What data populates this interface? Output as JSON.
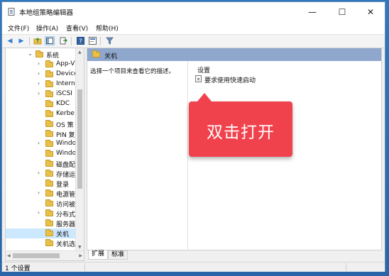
{
  "window": {
    "title": "本地组策略编辑器",
    "minimize": "—",
    "maximize": "☐",
    "close": "✕"
  },
  "menu": [
    {
      "label": "文件(F)"
    },
    {
      "label": "操作(A)"
    },
    {
      "label": "查看(V)"
    },
    {
      "label": "帮助(H)"
    }
  ],
  "tree": {
    "items": [
      {
        "label": "系统",
        "arrow": "open"
      },
      {
        "label": "App-V",
        "arrow": "closed"
      },
      {
        "label": "Device",
        "arrow": "closed"
      },
      {
        "label": "Intern",
        "arrow": "closed"
      },
      {
        "label": "iSCSI",
        "arrow": "closed"
      },
      {
        "label": "KDC",
        "arrow": "none"
      },
      {
        "label": "Kerbe",
        "arrow": "none"
      },
      {
        "label": "OS 策",
        "arrow": "none"
      },
      {
        "label": "PIN 复",
        "arrow": "none"
      },
      {
        "label": "Windo",
        "arrow": "closed"
      },
      {
        "label": "Windo",
        "arrow": "none"
      },
      {
        "label": "磁盘配",
        "arrow": "none"
      },
      {
        "label": "存储运",
        "arrow": "closed"
      },
      {
        "label": "登录",
        "arrow": "none"
      },
      {
        "label": "电源管",
        "arrow": "closed"
      },
      {
        "label": "访问被",
        "arrow": "none"
      },
      {
        "label": "分布式",
        "arrow": "closed"
      },
      {
        "label": "服务器",
        "arrow": "none"
      },
      {
        "label": "关机",
        "arrow": "none",
        "selected": true
      },
      {
        "label": "关机选",
        "arrow": "none"
      }
    ]
  },
  "right": {
    "header": "关机",
    "description": "选择一个项目来查看它的描述。",
    "column_header": "设置",
    "settings": [
      {
        "label": "要求使用快速启动"
      }
    ]
  },
  "callout": {
    "text": "双击打开"
  },
  "tabs": [
    {
      "label": "扩展"
    },
    {
      "label": "标准"
    }
  ],
  "status": {
    "text": "1 个设置"
  }
}
